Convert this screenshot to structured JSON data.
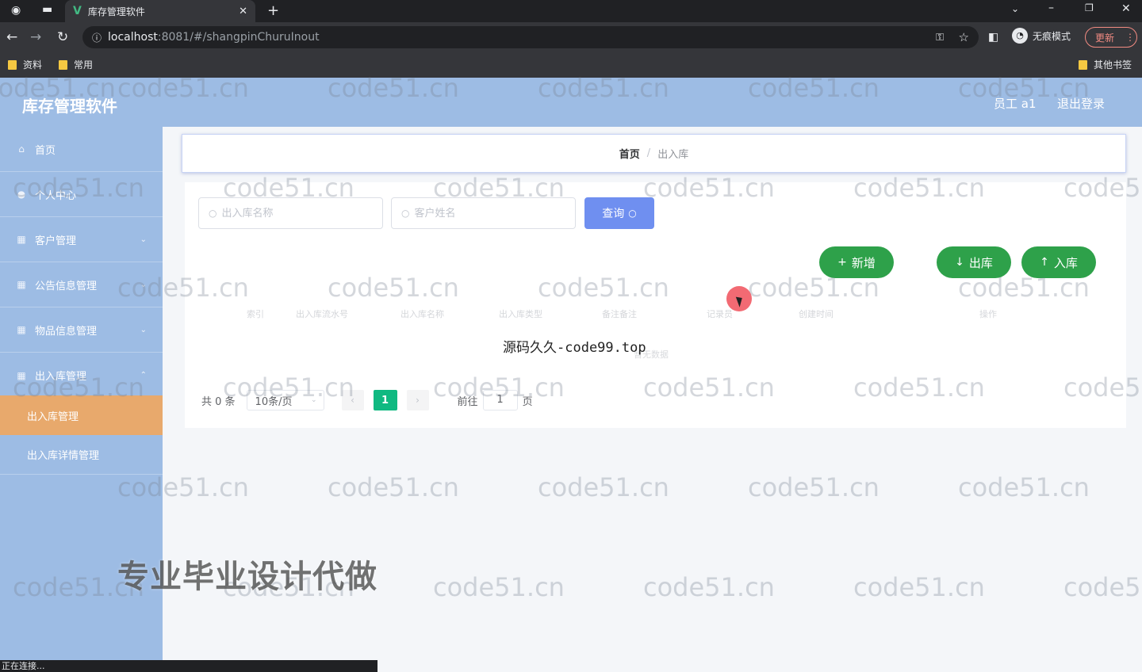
{
  "browser": {
    "tab_title": "库存管理软件",
    "tab_logo": "V",
    "url_host": "localhost",
    "url_rest": ":8081/#/shangpinChuruInout",
    "incognito_label": "无痕模式",
    "update_label": "更新",
    "bookmarks": [
      "资料",
      "常用"
    ],
    "other_bookmarks": "其他书签"
  },
  "header": {
    "title": "库存管理软件",
    "user": "员工 a1",
    "logout": "退出登录"
  },
  "sidebar": {
    "items": [
      {
        "label": "首页",
        "icon": "home-icon"
      },
      {
        "label": "个人中心",
        "icon": "user-icon"
      },
      {
        "label": "客户管理",
        "icon": "grid-icon"
      },
      {
        "label": "公告信息管理",
        "icon": "grid-icon"
      },
      {
        "label": "物品信息管理",
        "icon": "grid-icon"
      },
      {
        "label": "出入库管理",
        "icon": "grid-icon"
      }
    ],
    "sub_items": [
      {
        "label": "出入库管理",
        "active": true
      },
      {
        "label": "出入库详情管理",
        "active": false
      }
    ]
  },
  "breadcrumb": {
    "home": "首页",
    "separator": "/",
    "current": "出入库"
  },
  "search": {
    "name_placeholder": "出入库名称",
    "customer_placeholder": "客户姓名",
    "query_label": "查询"
  },
  "actions": {
    "add_label": "新增",
    "out_label": "出库",
    "in_label": "入库"
  },
  "table": {
    "columns": [
      "索引",
      "出入库流水号",
      "出入库名称",
      "出入库类型",
      "备注备注",
      "记录员",
      "创建时间",
      "操作"
    ],
    "empty_text": "暂无数据"
  },
  "pager": {
    "total": "共 0 条",
    "page_size": "10条/页",
    "current_page": "1",
    "goto_label": "前往",
    "goto_value": "1",
    "page_suffix": "页"
  },
  "overlays": {
    "watermark": "code51.cn",
    "source_text": "源码久久-code99.top",
    "promo": "专业毕业设计代做",
    "status": "正在连接..."
  },
  "colors": {
    "header_bg": "#9dbce4",
    "active_sub": "#e8a96c",
    "query_btn": "#6f8ff0",
    "green_btn": "#2ea14a",
    "page_active": "#10b981"
  }
}
